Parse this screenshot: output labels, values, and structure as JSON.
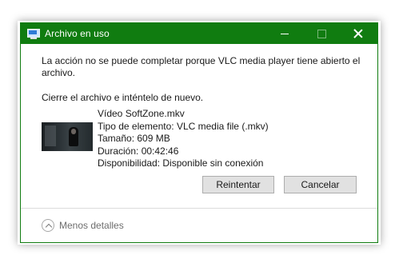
{
  "window": {
    "title": "Archivo en uso",
    "accent_color": "#107c10",
    "icon": "monitor-icon"
  },
  "titlebar_controls": {
    "minimize_icon": "minimize-icon",
    "maximize_icon": "maximize-icon",
    "close_icon": "close-icon"
  },
  "message": "La acción no se puede completar porque VLC media player tiene abierto el archivo.",
  "instruction": "Cierre el archivo e inténtelo de nuevo.",
  "file": {
    "name": "Vídeo SoftZone.mkv",
    "type": "Tipo de elemento: VLC media file (.mkv)",
    "size": "Tamaño: 609 MB",
    "duration": "Duración: 00:42:46",
    "availability": "Disponibilidad: Disponible sin conexión"
  },
  "buttons": {
    "retry": "Reintentar",
    "cancel": "Cancelar"
  },
  "footer": {
    "details_label": "Menos detalles",
    "details_icon": "chevron-up-icon"
  }
}
